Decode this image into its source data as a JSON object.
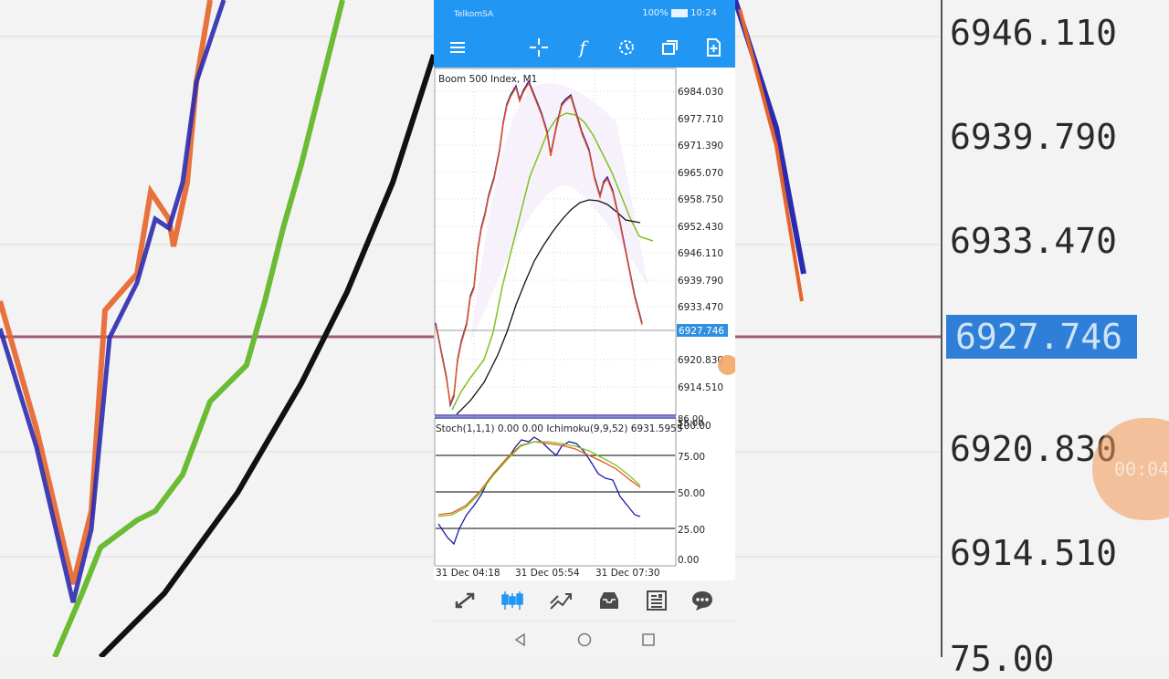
{
  "status_bar": {
    "carrier": "TelkomSA",
    "battery": "100%",
    "time": "10:24"
  },
  "toolbar": {
    "icons": [
      "menu-icon",
      "crosshair-icon",
      "function-icon",
      "timeframe-icon",
      "window-icon",
      "new-order-icon"
    ]
  },
  "chart": {
    "symbol_label": "Boom 500 Index, M1",
    "price_levels": [
      "6984.030",
      "6977.710",
      "6971.390",
      "6965.070",
      "6958.750",
      "6952.430",
      "6946.110",
      "6939.790",
      "6933.470",
      "6920.830",
      "6914.510"
    ],
    "current_price": "6927.746",
    "indicator_label": "Stoch(1,1,1) 0.00 0.00 Ichimoku(9,9,52) 6931.5955",
    "sub_levels": [
      "100.00",
      "75.00",
      "50.00",
      "25.00",
      "0.00"
    ],
    "sub_top_overlap": [
      "86.00",
      "55.00"
    ],
    "time_labels": [
      "31 Dec 04:18",
      "31 Dec 05:54",
      "31 Dec 07:30"
    ],
    "colors": {
      "accent": "#2196f3",
      "bear": "#e8541e",
      "bull": "#1a1aa8",
      "green_ma": "#7cc41b",
      "black_ma": "#111111",
      "stoch_main": "#1a1aa8",
      "stoch_red": "#e8541e",
      "stoch_green": "#7cc41b"
    }
  },
  "background": {
    "prices": [
      "6946.110",
      "6939.790",
      "6933.470",
      "6920.830",
      "6914.510",
      "75.00"
    ],
    "current_price": "6927.746",
    "timer": "00:04"
  },
  "bottom_nav": {
    "items": [
      "quotes-icon",
      "chart-icon",
      "trade-icon",
      "history-icon",
      "news-icon",
      "chat-icon"
    ]
  },
  "system_nav": {
    "items": [
      "back-icon",
      "home-icon",
      "recents-icon"
    ]
  }
}
